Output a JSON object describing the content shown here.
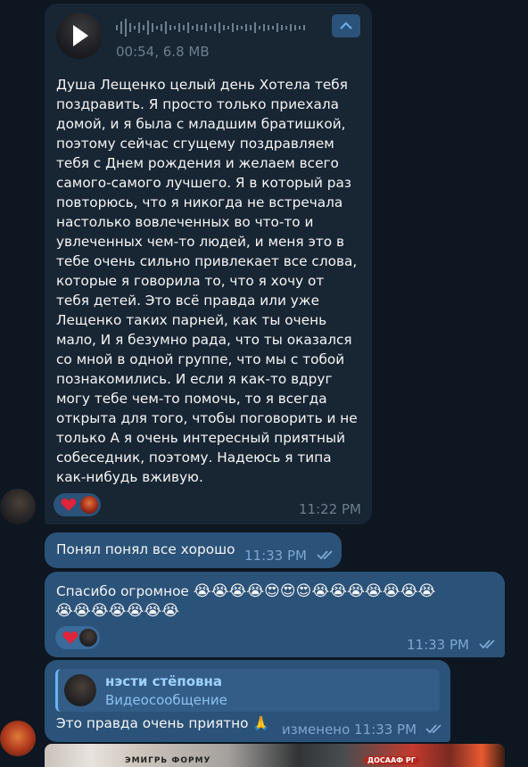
{
  "colors": {
    "background": "#0e1621",
    "incoming_bubble": "#182533",
    "outgoing_bubble": "#2b5278",
    "accent": "#6ab3f3",
    "meta_text": "#6d7f8f"
  },
  "voice_message": {
    "meta": "00:54, 6.8 MB",
    "play_icon": "play-icon",
    "collapse_icon": "chevron-up-icon",
    "transcript": "Душа Лещенко целый день Хотела тебя поздравить. Я просто только приехала домой, и я была с младшим братишкой, поэтому сейчас сгущему поздравляем тебя с Днем рождения и желаем всего самого-самого лучшего. Я в который раз повторюсь, что я никогда не встречала настолько вовлеченных во что-то и увлеченных чем-то людей, и меня это в тебе очень сильно привлекает все слова, которые я говорила то, что я хочу от тебя детей. Это всё правда или уже Лещенко таких парней, как ты очень мало, И я безумно рада, что ты оказался со мной в одной группе, что мы с тобой познакомились. И если я как-то вдруг могу тебе чем-то помочь, то я всегда открыта для того, чтобы поговорить и не только А я очень интересный приятный собеседник, поэтому. Надеюсь я типа как-нибудь вживую.",
    "reaction_icon": "heart-icon",
    "time": "11:22 PM"
  },
  "messages": [
    {
      "text": "Понял понял все хорошо",
      "time": "11:33 PM",
      "status_icon": "double-check-icon"
    },
    {
      "text": "Спасибо огромное",
      "emoji_line1": "😭😭😭😭😍😍😍😭😭😭😭😭😭😭",
      "emoji_line2": "😭😭😭😭😭😭😭",
      "reaction_icon": "heart-icon",
      "time": "11:33 PM",
      "status_icon": "double-check-icon"
    },
    {
      "reply_name": "нэсти стёповна",
      "reply_sub": "Видеосообщение",
      "text": "Это правда очень приятно 🙏",
      "time": "изменено 11:33 PM",
      "status_icon": "double-check-icon"
    }
  ],
  "media_preview": {
    "label_left": "ЭМИГРЬ ФОРМУ",
    "label_right": "ДОСААФ РГ"
  }
}
